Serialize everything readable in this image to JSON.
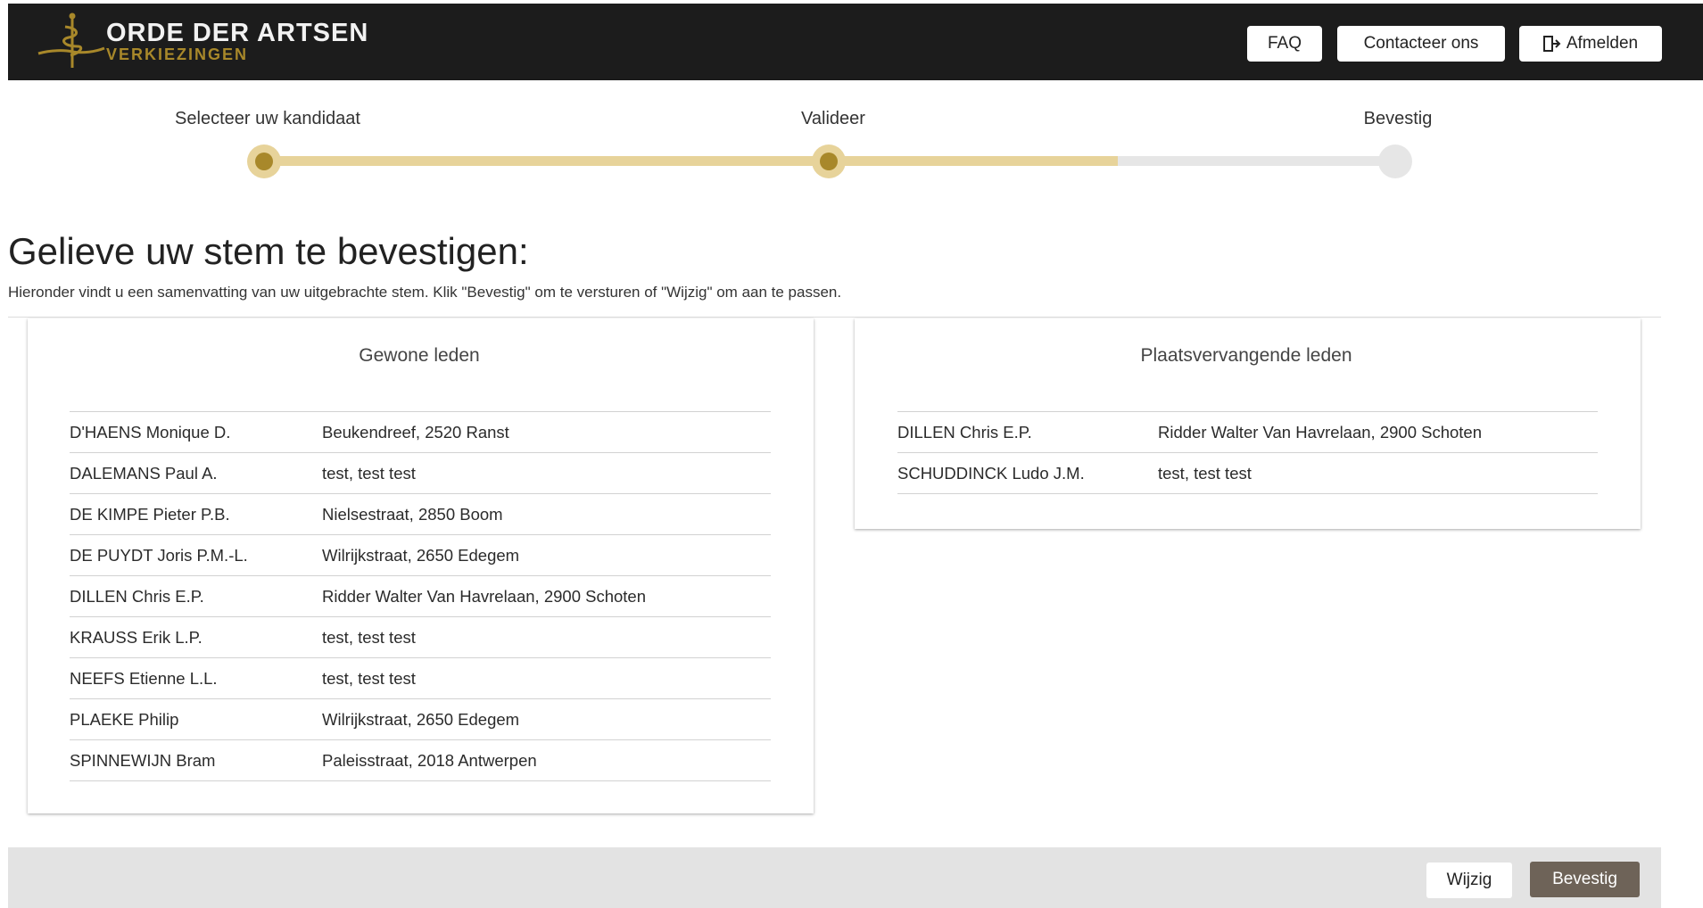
{
  "header": {
    "brand_title": "ORDE DER ARTSEN",
    "brand_subtitle": "VERKIEZINGEN",
    "faq_label": "FAQ",
    "contact_label": "Contacteer ons",
    "logout_label": "Afmelden",
    "logout_icon": "logout-icon"
  },
  "steps": [
    {
      "label": "Selecteer uw kandidaat",
      "state": "done"
    },
    {
      "label": "Valideer",
      "state": "done"
    },
    {
      "label": "Bevestig",
      "state": "todo"
    }
  ],
  "main": {
    "heading": "Gelieve uw stem te bevestigen:",
    "subtext": "Hieronder vindt u een samenvatting van uw uitgebrachte stem. Klik \"Bevestig\" om te versturen of \"Wijzig\" om aan te passen."
  },
  "regular": {
    "title": "Gewone leden",
    "rows": [
      {
        "name": "D'HAENS Monique D.",
        "address": "Beukendreef, 2520 Ranst"
      },
      {
        "name": "DALEMANS Paul A.",
        "address": "test, test test"
      },
      {
        "name": "DE KIMPE Pieter P.B.",
        "address": "Nielsestraat, 2850 Boom"
      },
      {
        "name": "DE PUYDT Joris P.M.-L.",
        "address": "Wilrijkstraat, 2650 Edegem"
      },
      {
        "name": "DILLEN Chris E.P.",
        "address": "Ridder Walter Van Havrelaan, 2900 Schoten"
      },
      {
        "name": "KRAUSS Erik L.P.",
        "address": "test, test test"
      },
      {
        "name": "NEEFS Etienne L.L.",
        "address": "test, test test"
      },
      {
        "name": "PLAEKE Philip",
        "address": "Wilrijkstraat, 2650 Edegem"
      },
      {
        "name": "SPINNEWIJN Bram",
        "address": "Paleisstraat, 2018 Antwerpen"
      }
    ]
  },
  "substitute": {
    "title": "Plaatsvervangende leden",
    "rows": [
      {
        "name": "DILLEN Chris E.P.",
        "address": "Ridder Walter Van Havrelaan, 2900 Schoten"
      },
      {
        "name": "SCHUDDINCK Ludo J.M.",
        "address": "test, test test"
      }
    ]
  },
  "footer": {
    "edit_label": "Wijzig",
    "confirm_label": "Bevestig"
  },
  "colors": {
    "topbar": "#1c1c1c",
    "gold": "#a8882a",
    "gold_light": "#e7d39a",
    "confirm_button": "#6e6358"
  }
}
